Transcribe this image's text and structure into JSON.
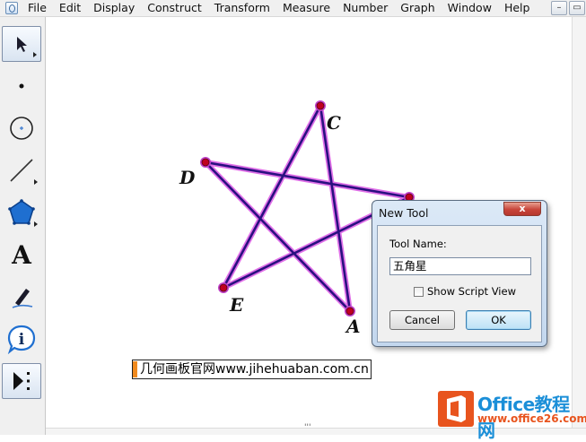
{
  "menu": [
    "File",
    "Edit",
    "Display",
    "Construct",
    "Transform",
    "Measure",
    "Number",
    "Graph",
    "Window",
    "Help"
  ],
  "window_buttons": {
    "minimize": "–",
    "restore": "▭"
  },
  "tools": [
    {
      "name": "selection-arrow-tool",
      "active": true
    },
    {
      "name": "point-tool"
    },
    {
      "name": "compass-tool"
    },
    {
      "name": "straightedge-tool"
    },
    {
      "name": "polygon-tool"
    },
    {
      "name": "text-tool",
      "glyph": "A"
    },
    {
      "name": "marker-tool"
    },
    {
      "name": "information-tool",
      "glyph": "i"
    },
    {
      "name": "custom-tools",
      "active": true
    }
  ],
  "canvas": {
    "point_labels": {
      "A": "A",
      "C": "C",
      "D": "D",
      "E": "E"
    },
    "caption": "几何画板官网www.jihehuaban.com.cn",
    "colors": {
      "segment": "#2a1080",
      "segment_glow": "#e070e8",
      "point_fill": "#c00020",
      "point_ring": "#c040c8"
    }
  },
  "dialog": {
    "title": "New Tool",
    "close": "x",
    "tool_name_label": "Tool Name:",
    "tool_name_value": "五角星",
    "show_script_label": "Show Script View",
    "show_script_checked": false,
    "cancel": "Cancel",
    "ok": "OK"
  },
  "watermark": {
    "main": "Office教程网",
    "url": "www.office26.com"
  },
  "scrollbar": {
    "thumb_glyph": "'''"
  }
}
